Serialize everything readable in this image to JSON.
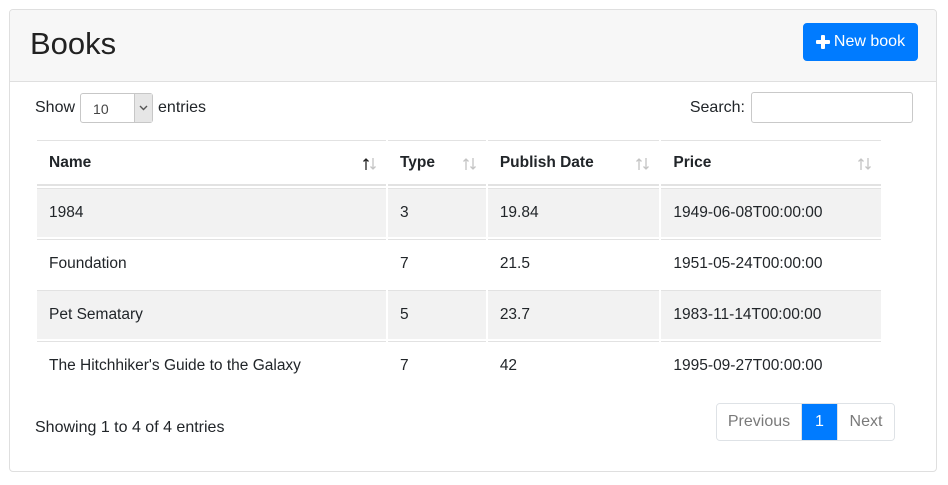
{
  "header": {
    "title": "Books",
    "new_button_label": "New book"
  },
  "length": {
    "prefix": "Show",
    "value": "10",
    "suffix": "entries"
  },
  "search": {
    "label": "Search:",
    "value": ""
  },
  "table": {
    "columns": [
      "Name",
      "Type",
      "Publish Date",
      "Price"
    ],
    "rows": [
      [
        "1984",
        "3",
        "19.84",
        "1949-06-08T00:00:00"
      ],
      [
        "Foundation",
        "7",
        "21.5",
        "1951-05-24T00:00:00"
      ],
      [
        "Pet Sematary",
        "5",
        "23.7",
        "1983-11-14T00:00:00"
      ],
      [
        "The Hitchhiker's Guide to the Galaxy",
        "7",
        "42",
        "1995-09-27T00:00:00"
      ]
    ]
  },
  "footer": {
    "info": "Showing 1 to 4 of 4 entries",
    "previous": "Previous",
    "current_page": "1",
    "next": "Next"
  },
  "icons": {
    "new_button": "plus-icon",
    "sort_active": "sort-up-icon",
    "sort": "sort-both-icon"
  },
  "colors": {
    "primary": "#007bff",
    "header_bg": "#f7f7f7",
    "stripe": "#f2f2f2"
  }
}
